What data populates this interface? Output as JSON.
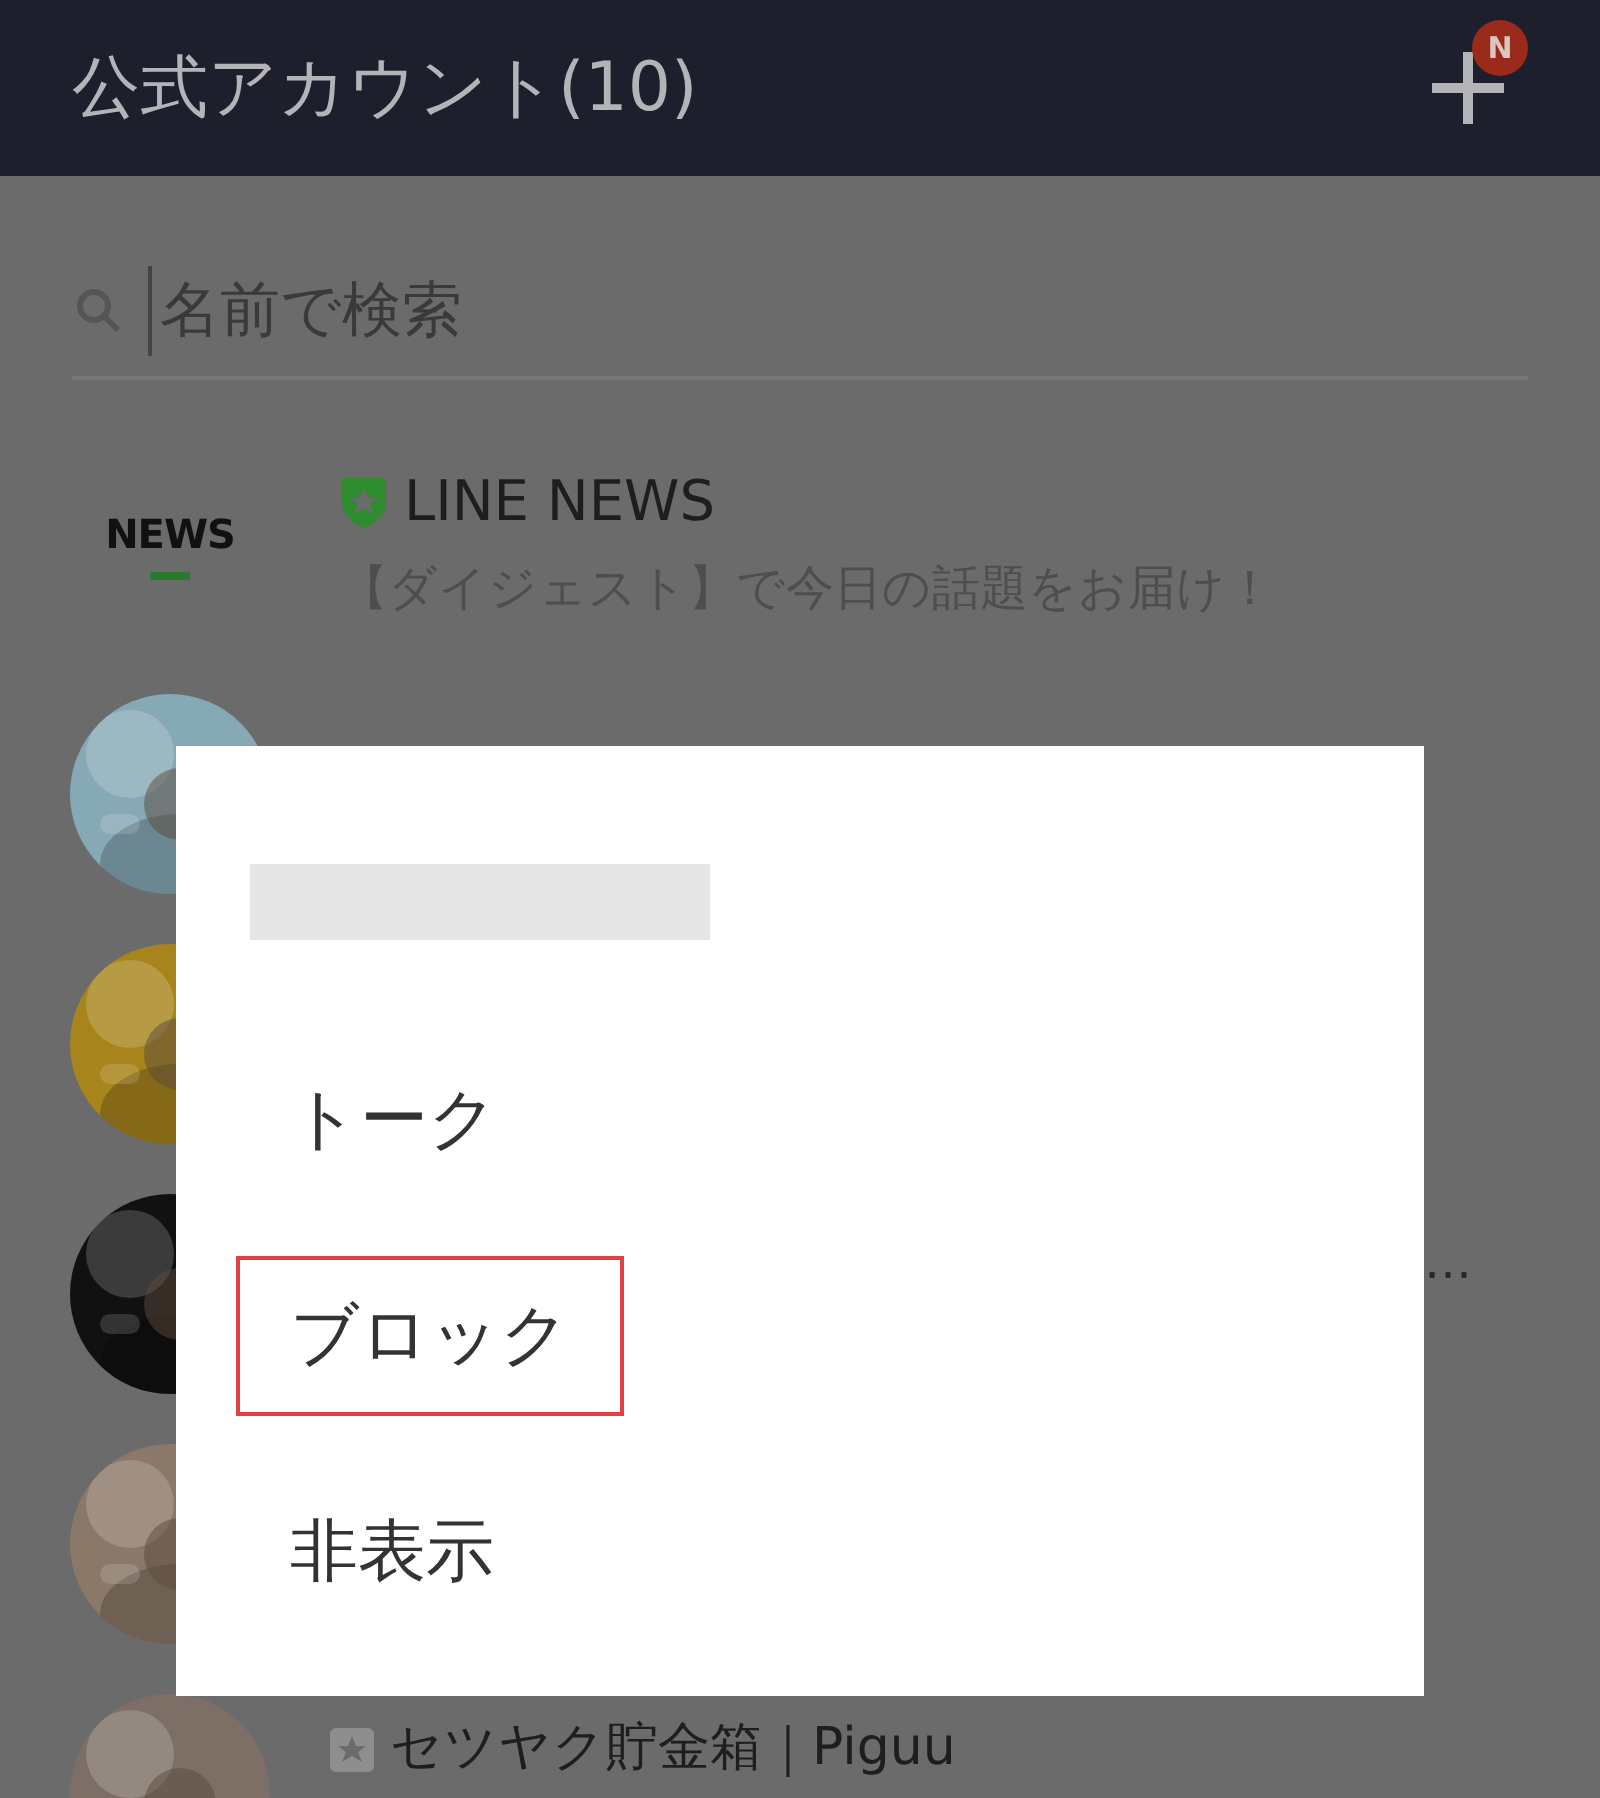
{
  "header": {
    "title": "公式アカウント(10)",
    "badge": "N"
  },
  "search": {
    "placeholder": "名前で検索"
  },
  "rows": [
    {
      "kind": "news",
      "logo": "NEWS",
      "name": "LINE NEWS",
      "message": "【ダイジェスト】で今日の話題をお届け！"
    },
    {
      "kind": "avatar"
    },
    {
      "kind": "avatar"
    },
    {
      "kind": "avatar",
      "trailing": "…"
    },
    {
      "kind": "avatar"
    },
    {
      "kind": "avatar",
      "name": "セツヤク貯金箱｜Piguu"
    }
  ],
  "dialog": {
    "items": [
      {
        "label": "トーク",
        "highlighted": false
      },
      {
        "label": "ブロック",
        "highlighted": true
      },
      {
        "label": "非表示",
        "highlighted": false
      }
    ]
  }
}
